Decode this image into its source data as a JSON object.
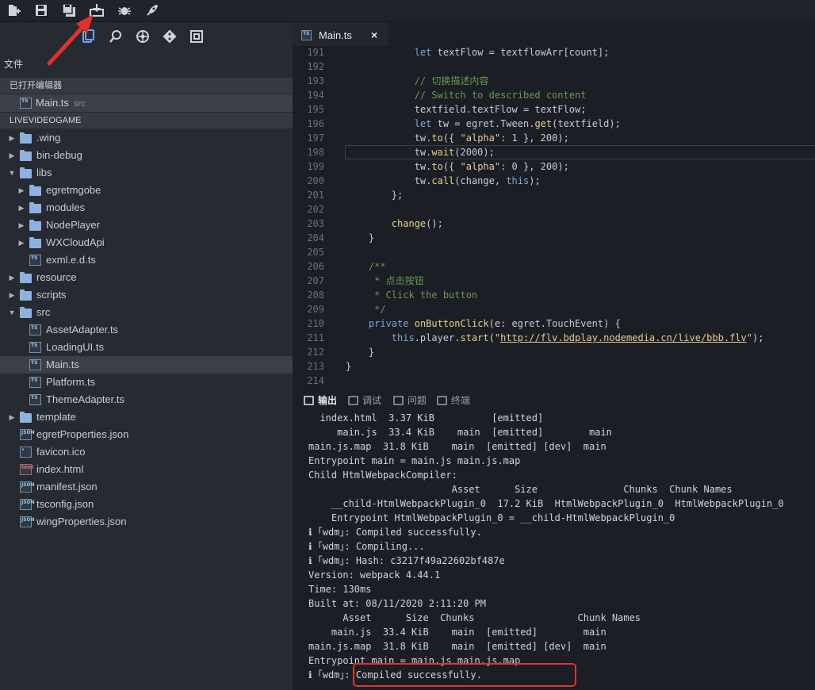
{
  "toolbar": {
    "icons": [
      "new-file-icon",
      "save-icon",
      "save-all-icon",
      "build-icon",
      "debug-icon",
      "publish-icon"
    ]
  },
  "sidebar": {
    "tools": [
      "explorer-icon",
      "search-icon",
      "extensions-icon",
      "git-icon",
      "outline-icon"
    ],
    "files_label": "文件",
    "open_editors_label": "已打开编辑器",
    "open_editor": {
      "name": "Main.ts",
      "dir": "src"
    },
    "project_label": "LIVEVIDEOGAME",
    "tree": [
      {
        "label": ".wing",
        "type": "folder",
        "depth": 0,
        "arrow": "▶"
      },
      {
        "label": "bin-debug",
        "type": "folder",
        "depth": 0,
        "arrow": "▶"
      },
      {
        "label": "libs",
        "type": "folder",
        "depth": 0,
        "arrow": "▼"
      },
      {
        "label": "egretmgobe",
        "type": "folder",
        "depth": 1,
        "arrow": "▶"
      },
      {
        "label": "modules",
        "type": "folder",
        "depth": 1,
        "arrow": "▶"
      },
      {
        "label": "NodePlayer",
        "type": "folder",
        "depth": 1,
        "arrow": "▶"
      },
      {
        "label": "WXCloudApi",
        "type": "folder",
        "depth": 1,
        "arrow": "▶"
      },
      {
        "label": "exml.e.d.ts",
        "type": "ts",
        "depth": 1,
        "arrow": ""
      },
      {
        "label": "resource",
        "type": "folder",
        "depth": 0,
        "arrow": "▶"
      },
      {
        "label": "scripts",
        "type": "folder",
        "depth": 0,
        "arrow": "▶"
      },
      {
        "label": "src",
        "type": "folder",
        "depth": 0,
        "arrow": "▼"
      },
      {
        "label": "AssetAdapter.ts",
        "type": "ts",
        "depth": 1,
        "arrow": ""
      },
      {
        "label": "LoadingUI.ts",
        "type": "ts",
        "depth": 1,
        "arrow": ""
      },
      {
        "label": "Main.ts",
        "type": "ts",
        "depth": 1,
        "arrow": "",
        "selected": true
      },
      {
        "label": "Platform.ts",
        "type": "ts",
        "depth": 1,
        "arrow": ""
      },
      {
        "label": "ThemeAdapter.ts",
        "type": "ts",
        "depth": 1,
        "arrow": ""
      },
      {
        "label": "template",
        "type": "folder",
        "depth": 0,
        "arrow": "▶"
      },
      {
        "label": "egretProperties.json",
        "type": "json",
        "depth": 0,
        "arrow": ""
      },
      {
        "label": "favicon.ico",
        "type": "ico",
        "depth": 0,
        "arrow": ""
      },
      {
        "label": "index.html",
        "type": "html",
        "depth": 0,
        "arrow": ""
      },
      {
        "label": "manifest.json",
        "type": "json",
        "depth": 0,
        "arrow": ""
      },
      {
        "label": "tsconfig.json",
        "type": "json",
        "depth": 0,
        "arrow": ""
      },
      {
        "label": "wingProperties.json",
        "type": "json",
        "depth": 0,
        "arrow": ""
      }
    ]
  },
  "editor": {
    "tab_label": "Main.ts",
    "tab_close": "×",
    "ts_badge": "TS",
    "current_line": 198,
    "lines": [
      {
        "n": "191",
        "html": "            <span class=\"kw\">let</span> textFlow = textflowArr[count];"
      },
      {
        "n": "192",
        "html": ""
      },
      {
        "n": "193",
        "html": "            <span class=\"cm\">// 切换描述内容</span>"
      },
      {
        "n": "194",
        "html": "            <span class=\"cm\">// Switch to described content</span>"
      },
      {
        "n": "195",
        "html": "            textfield.textFlow = textFlow;"
      },
      {
        "n": "196",
        "html": "            <span class=\"kw\">let</span> tw = egret.Tween.<span class=\"fn\">get</span>(textfield);"
      },
      {
        "n": "197",
        "html": "            tw.<span class=\"fn\">to</span>({ <span class=\"str\">\"alpha\"</span>: 1 }, 200);"
      },
      {
        "n": "198",
        "html": "            tw.<span class=\"fn\">wait</span>(2000);"
      },
      {
        "n": "199",
        "html": "            tw.<span class=\"fn\">to</span>({ <span class=\"str\">\"alpha\"</span>: 0 }, 200);"
      },
      {
        "n": "200",
        "html": "            tw.<span class=\"fn\">call</span>(change, <span class=\"kw\">this</span>);"
      },
      {
        "n": "201",
        "html": "        };"
      },
      {
        "n": "202",
        "html": ""
      },
      {
        "n": "203",
        "html": "        <span class=\"fn\">change</span>();"
      },
      {
        "n": "204",
        "html": "    }"
      },
      {
        "n": "205",
        "html": ""
      },
      {
        "n": "206",
        "html": "    <span class=\"cm\">/**</span>"
      },
      {
        "n": "207",
        "html": "<span class=\"cm\">     * 点击按钮</span>"
      },
      {
        "n": "208",
        "html": "<span class=\"cm\">     * Click the button</span>"
      },
      {
        "n": "209",
        "html": "<span class=\"cm\">     */</span>"
      },
      {
        "n": "210",
        "html": "    <span class=\"kw\">private</span> <span class=\"fn\">onButtonClick</span>(e: egret.TouchEvent) {"
      },
      {
        "n": "211",
        "html": "        <span class=\"kw\">this</span>.player.<span class=\"fn\">start</span>(<span class=\"str\">\"</span><span class=\"url\">http://flv.bdplay.nodemedia.cn/live/bbb.flv</span><span class=\"str\">\"</span>);"
      },
      {
        "n": "212",
        "html": "    }"
      },
      {
        "n": "213",
        "html": "}"
      },
      {
        "n": "214",
        "html": ""
      }
    ]
  },
  "panel": {
    "tabs": [
      {
        "label": "输出",
        "icon": "output-icon",
        "active": true
      },
      {
        "label": "调试",
        "icon": "debug-console-icon",
        "active": false
      },
      {
        "label": "问题",
        "icon": "problems-icon",
        "active": false
      },
      {
        "label": "终端",
        "icon": "terminal-icon",
        "active": false
      }
    ],
    "output": [
      "  index.html  3.37 KiB          [emitted]",
      "     main.js  33.4 KiB    main  [emitted]        main",
      "main.js.map  31.8 KiB    main  [emitted] [dev]  main",
      "Entrypoint main = main.js main.js.map",
      "Child HtmlWebpackCompiler:",
      "                         Asset      Size               Chunks  Chunk Names",
      "    __child-HtmlWebpackPlugin_0  17.2 KiB  HtmlWebpackPlugin_0  HtmlWebpackPlugin_0",
      "    Entrypoint HtmlWebpackPlugin_0 = __child-HtmlWebpackPlugin_0",
      "ℹ ｢wdm｣: Compiled successfully.",
      "ℹ ｢wdm｣: Compiling...",
      "ℹ ｢wdm｣: Hash: c3217f49a22602bf487e",
      "Version: webpack 4.44.1",
      "Time: 130ms",
      "Built at: 08/11/2020 2:11:20 PM",
      "      Asset      Size  Chunks                  Chunk Names",
      "    main.js  33.4 KiB    main  [emitted]        main",
      "main.js.map  31.8 KiB    main  [emitted] [dev]  main",
      "Entrypoint main = main.js main.js.map",
      "ℹ ｢wdm｣: Compiled successfully."
    ]
  },
  "colors": {
    "annotation_red": "#e3312c",
    "accent_blue": "#7fa8d8"
  }
}
